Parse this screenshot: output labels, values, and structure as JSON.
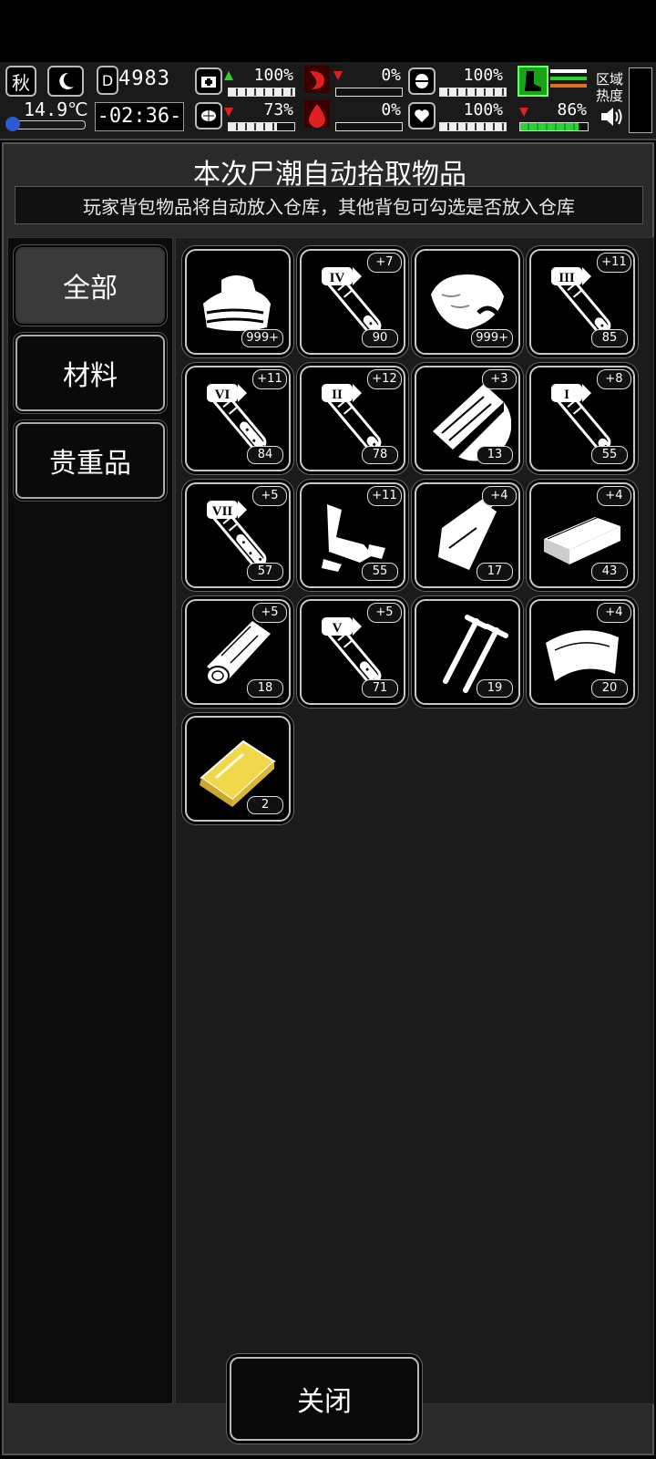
{
  "hud": {
    "season": "秋",
    "temperature": "14.9℃",
    "day": "4983",
    "time": "-02:36-",
    "stats": [
      {
        "id": "health",
        "value": "100%",
        "trend": "up",
        "fill": 1.0
      },
      {
        "id": "stomach",
        "value": "0%",
        "trend": "down",
        "fill": 0.0
      },
      {
        "id": "stamina",
        "value": "100%",
        "trend": "none",
        "fill": 1.0
      },
      {
        "id": "brain",
        "value": "73%",
        "trend": "down",
        "fill": 0.73
      },
      {
        "id": "blood",
        "value": "0%",
        "trend": "none",
        "fill": 0.0
      },
      {
        "id": "mood",
        "value": "100%",
        "trend": "none",
        "fill": 1.0
      },
      {
        "id": "energy",
        "value": "86%",
        "trend": "down",
        "fill": 0.86
      }
    ],
    "region_heat_label": "区域热度"
  },
  "panel": {
    "title": "本次尸潮自动拾取物品",
    "subtitle": "玩家背包物品将自动放入仓库，其他背包可勾选是否放入仓库"
  },
  "tabs": [
    {
      "label": "全部",
      "active": true
    },
    {
      "label": "材料",
      "active": false
    },
    {
      "label": "贵重品",
      "active": false
    }
  ],
  "items": [
    {
      "icon": "cloth-icon",
      "count": "999+",
      "plus": ""
    },
    {
      "icon": "test-tube-icon",
      "tier": "IV",
      "count": "90",
      "plus": "+7",
      "fill": 0.45
    },
    {
      "icon": "meat-icon",
      "count": "999+",
      "plus": ""
    },
    {
      "icon": "test-tube-icon",
      "tier": "III",
      "count": "85",
      "plus": "+11",
      "fill": 0.4
    },
    {
      "icon": "test-tube-icon",
      "tier": "VI",
      "count": "84",
      "plus": "+11",
      "fill": 0.7
    },
    {
      "icon": "test-tube-icon",
      "tier": "II",
      "count": "78",
      "plus": "+12",
      "fill": 0.35
    },
    {
      "icon": "wood-board-icon",
      "count": "13",
      "plus": "+3"
    },
    {
      "icon": "test-tube-icon",
      "tier": "I",
      "count": "55",
      "plus": "+8",
      "fill": 0.3
    },
    {
      "icon": "test-tube-icon",
      "tier": "VII",
      "count": "57",
      "plus": "+5",
      "fill": 0.8
    },
    {
      "icon": "pipe-scrap-icon",
      "count": "55",
      "plus": "+11"
    },
    {
      "icon": "plastic-bag-icon",
      "count": "17",
      "plus": "+4"
    },
    {
      "icon": "brick-icon",
      "count": "43",
      "plus": "+4"
    },
    {
      "icon": "log-icon",
      "count": "18",
      "plus": "+5"
    },
    {
      "icon": "test-tube-icon",
      "tier": "V",
      "count": "71",
      "plus": "+5",
      "fill": 0.55
    },
    {
      "icon": "nails-icon",
      "count": "19",
      "plus": ""
    },
    {
      "icon": "metal-sheet-icon",
      "count": "20",
      "plus": "+4"
    },
    {
      "icon": "gold-bar-icon",
      "count": "2",
      "plus": ""
    }
  ],
  "footer": {
    "close_label": "关闭"
  }
}
